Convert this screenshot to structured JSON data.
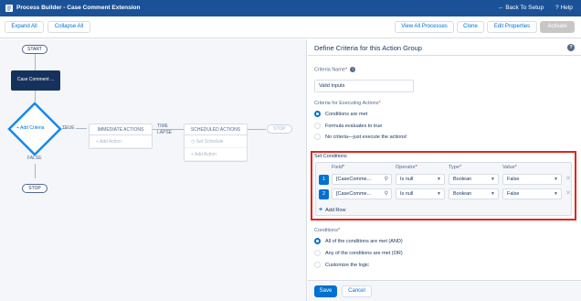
{
  "topbar": {
    "title": "Process Builder - Case Comment Extension",
    "back_to_setup": "Back To Setup",
    "help": "Help"
  },
  "toolbar": {
    "expand_all": "Expand All",
    "collapse_all": "Collapse All",
    "view_all_processes": "View All Processes",
    "clone": "Clone",
    "edit_properties": "Edit Properties",
    "activate": "Activate"
  },
  "canvas": {
    "start": "START",
    "object_node": "Case Comment ...",
    "add_criteria": "Add Criteria",
    "true_label": "TRUE",
    "false_label": "FALSE",
    "stop_bottom": "STOP",
    "stop_right": "STOP",
    "immediate_actions": "IMMEDIATE ACTIONS",
    "add_action_immediate": "Add Action",
    "time_lapse": "TIME LAPSE",
    "scheduled_actions": "SCHEDULED ACTIONS",
    "set_schedule": "Set Schedule",
    "add_action_scheduled": "Add Action"
  },
  "panel": {
    "title": "Define Criteria for this Action Group",
    "criteria_name_label": "Criteria Name",
    "criteria_name_value": "Valid Inputs",
    "executing_label": "Criteria for Executing Actions",
    "executing_options": [
      "Conditions are met",
      "Formula evaluates to true",
      "No criteria—just execute the actions!"
    ],
    "executing_selected": 0,
    "set_conditions_label": "Set Conditions",
    "columns": {
      "field": "Field",
      "operator": "Operator",
      "type": "Type",
      "value": "Value"
    },
    "rows": [
      {
        "num": "1",
        "field": "[CaseComme...",
        "operator": "Is null",
        "type": "Boolean",
        "value": "False"
      },
      {
        "num": "2",
        "field": "[CaseComme...",
        "operator": "Is null",
        "type": "Boolean",
        "value": "False"
      }
    ],
    "add_row": "Add Row",
    "conditions_label": "Conditions",
    "conditions_options": [
      "All of the conditions are met (AND)",
      "Any of the conditions are met (OR)",
      "Customize the logic"
    ],
    "conditions_selected": 0,
    "save": "Save",
    "cancel": "Cancel"
  },
  "colors": {
    "header": "#1b5297",
    "brand": "#0070d2",
    "highlight": "#e0261f"
  }
}
